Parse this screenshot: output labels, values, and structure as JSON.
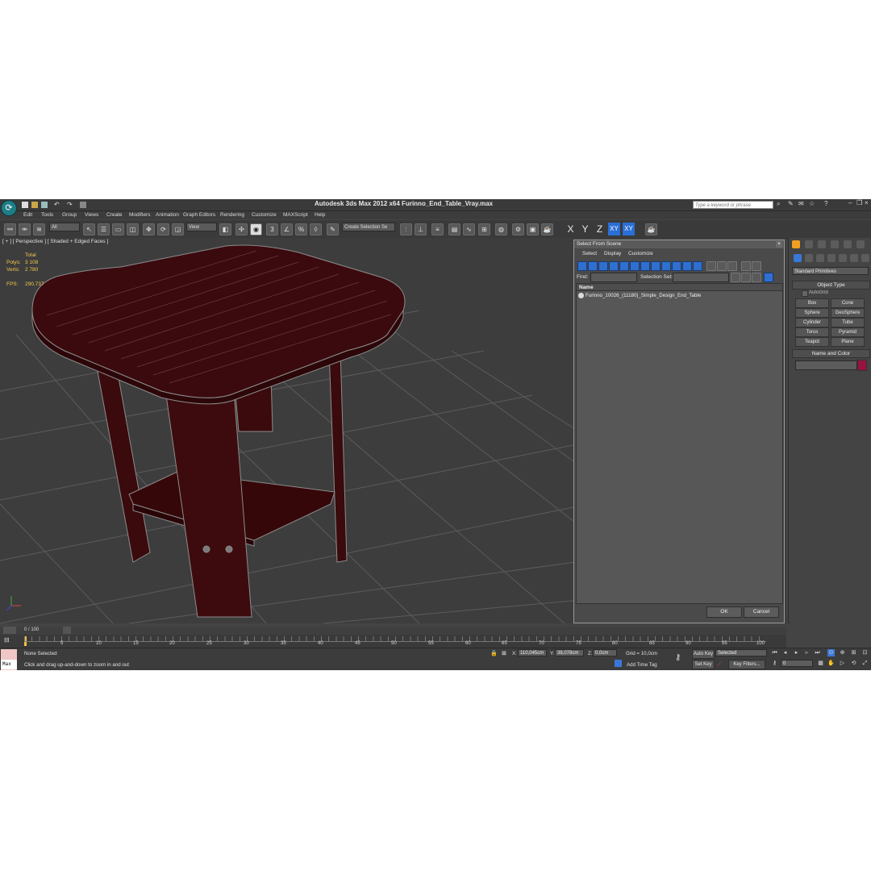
{
  "window": {
    "title": "Autodesk 3ds Max  2012 x64    Furinno_End_Table_Vray.max",
    "search_placeholder": "Type a keyword or phrase"
  },
  "menu": [
    "Edit",
    "Tools",
    "Group",
    "Views",
    "Create",
    "Modifiers",
    "Animation",
    "Graph Editors",
    "Rendering",
    "Customize",
    "MAXScript",
    "Help"
  ],
  "toolbar": {
    "filter_value": "All",
    "refcoord_value": "View",
    "selection_set_value": "Create Selection Se",
    "axes": [
      "X",
      "Y",
      "Z",
      "XY",
      "XY"
    ],
    "icons": [
      "link-icon",
      "unlink-icon",
      "bind-spacewarp-icon",
      "select-icon",
      "select-by-name-icon",
      "rect-region-icon",
      "window-crossing-icon",
      "move-icon",
      "rotate-icon",
      "scale-icon",
      "pivot-icon",
      "manipulate-icon",
      "snaps-3-icon",
      "angle-snap-icon",
      "percent-snap-icon",
      "spinner-snap-icon",
      "edit-named-sel-icon",
      "mirror-icon",
      "align-icon",
      "layer-icon",
      "graphite-icon",
      "curve-editor-icon",
      "schematic-icon",
      "material-editor-icon",
      "render-setup-icon",
      "render-frame-icon",
      "render-icon",
      "teapot-icon"
    ]
  },
  "viewport": {
    "label": "[ + ] [ Perspective ] [ Shaded + Edged Faces ]",
    "stats": {
      "total_label": "Total",
      "polys_label": "Polys:",
      "polys": "3 108",
      "verts_label": "Verts:",
      "verts": "2 780",
      "fps_label": "FPS:",
      "fps": "290,737"
    }
  },
  "dialog": {
    "title": "Select From Scene",
    "menu": [
      "Select",
      "Display",
      "Customize"
    ],
    "find_label": "Find:",
    "selection_set_label": "Selection Set:",
    "column_name": "Name",
    "items": [
      "Furinno_10026_(11180)_Simple_Design_End_Table"
    ],
    "ok": "OK",
    "cancel": "Cancel"
  },
  "command_panel": {
    "category": "Standard Primitives",
    "object_type_title": "Object Type",
    "autogrid": "AutoGrid",
    "buttons": [
      "Box",
      "Cone",
      "Sphere",
      "GeoSphere",
      "Cylinder",
      "Tube",
      "Torus",
      "Pyramid",
      "Teapot",
      "Plane"
    ],
    "name_color_title": "Name and Color",
    "swatch_color": "#9a1240"
  },
  "timeline": {
    "frame": "0 / 100",
    "ticks": [
      "5",
      "10",
      "15",
      "20",
      "25",
      "30",
      "35",
      "40",
      "45",
      "50",
      "55",
      "60",
      "65",
      "70",
      "75",
      "80",
      "85",
      "90",
      "95",
      "100"
    ]
  },
  "status": {
    "maxscript": "Max",
    "selection": "None Selected",
    "prompt": "Click and drag up-and-down to zoom in and out",
    "x_label": "X:",
    "x": "110,045cm",
    "y_label": "Y:",
    "y": "38,078cm",
    "z_label": "Z:",
    "z": "0,0cm",
    "grid": "Grid = 10,0cm",
    "add_time_tag": "Add Time Tag",
    "auto_key": "Auto Key",
    "auto_key_value": "Selected",
    "set_key": "Set Key",
    "key_filters": "Key Filters...",
    "frame_value": "0"
  }
}
